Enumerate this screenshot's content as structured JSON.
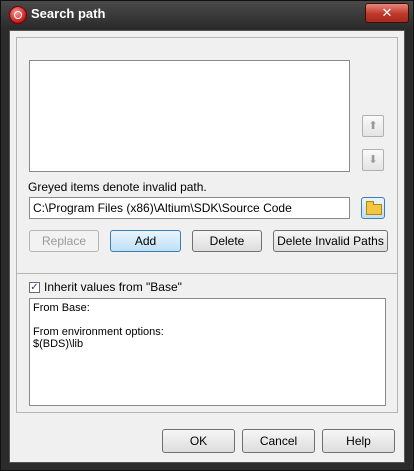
{
  "window": {
    "title": "Search path",
    "close_glyph": "✕"
  },
  "path_list": {
    "items": [],
    "move_up_glyph": "⬆",
    "move_down_glyph": "⬇"
  },
  "hint": "Greyed items denote invalid path.",
  "path_input": {
    "value": "C:\\Program Files (x86)\\Altium\\SDK\\Source Code"
  },
  "browse_button": {
    "icon": "folder-icon"
  },
  "actions": {
    "replace": "Replace",
    "add": "Add",
    "delete": "Delete",
    "delete_invalid": "Delete Invalid Paths"
  },
  "inherit": {
    "checked": true,
    "check_glyph": "✓",
    "label": "Inherit values from \"Base\"",
    "lines": [
      "From Base:",
      "",
      "From environment options:",
      "$(BDS)\\lib"
    ]
  },
  "footer": {
    "ok": "OK",
    "cancel": "Cancel",
    "help": "Help"
  }
}
